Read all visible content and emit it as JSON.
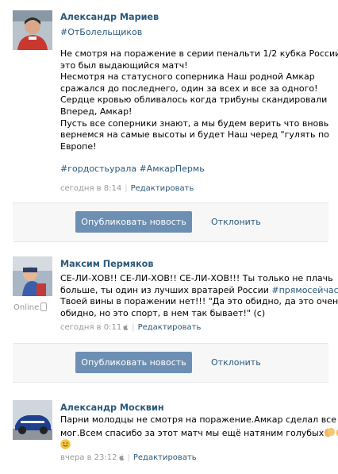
{
  "posts": [
    {
      "author": "Александр Мариев",
      "hashtag_header": "#ОтБолельщиков",
      "text_lines": [
        "Не смотря на поражение в серии пенальти 1/2 кубка России",
        "это был выдающийся матч!",
        "Несмотря на статусного соперника Наш родной Амкар",
        "сражался до последнего, один за всех и все за одного!",
        "Сердце кровью обливалось когда трибуны скандировали",
        "Вперед, Амкар!",
        "Пусть все соперники знают, а мы будем верить что вновь",
        "вернемся на самые высоты и будет Наш черед \"гулять по",
        "Европе!"
      ],
      "tags": "#гордостьурала #АмкарПермь",
      "time": "сегодня в 8:14",
      "edit": "Редактировать",
      "publish": "Опубликовать новость",
      "reject": "Отклонить"
    },
    {
      "author": "Максим Пермяков",
      "online": "Online",
      "text_lines": [
        "СЕ-ЛИ-ХОВ!! СЕ-ЛИ-ХОВ!! СЕ-ЛИ-ХОВ!!! Ты только не плачь",
        "больше, ты один из лучших вратарей России",
        "Твоей вины в поражении нет!!! \"Да это обидно, да это очень",
        "обидно, но это спорт, в нем так бывает!\" (с)"
      ],
      "inline_tag": "#прямосейчас!!!",
      "time": "сегодня в 0:11",
      "edit": "Редактировать",
      "publish": "Опубликовать новость",
      "reject": "Отклонить"
    },
    {
      "author": "Александр Москвин",
      "text_lines": [
        "Парни молодцы не смотря на поражение.Амкар сделал все что",
        "мог.Всем спасибо за этот матч мы ещё натяним голубых"
      ],
      "time": "вчера в 23:12",
      "edit": "Редактировать"
    }
  ],
  "icons": {
    "apple": "apple-icon",
    "phone": "mobile-phone-icon",
    "clap": "clapping-hands-emoji",
    "smile": "smile-emoji"
  },
  "colors": {
    "link": "#2b587a",
    "button": "#6d8fb3",
    "meta": "#999999"
  }
}
